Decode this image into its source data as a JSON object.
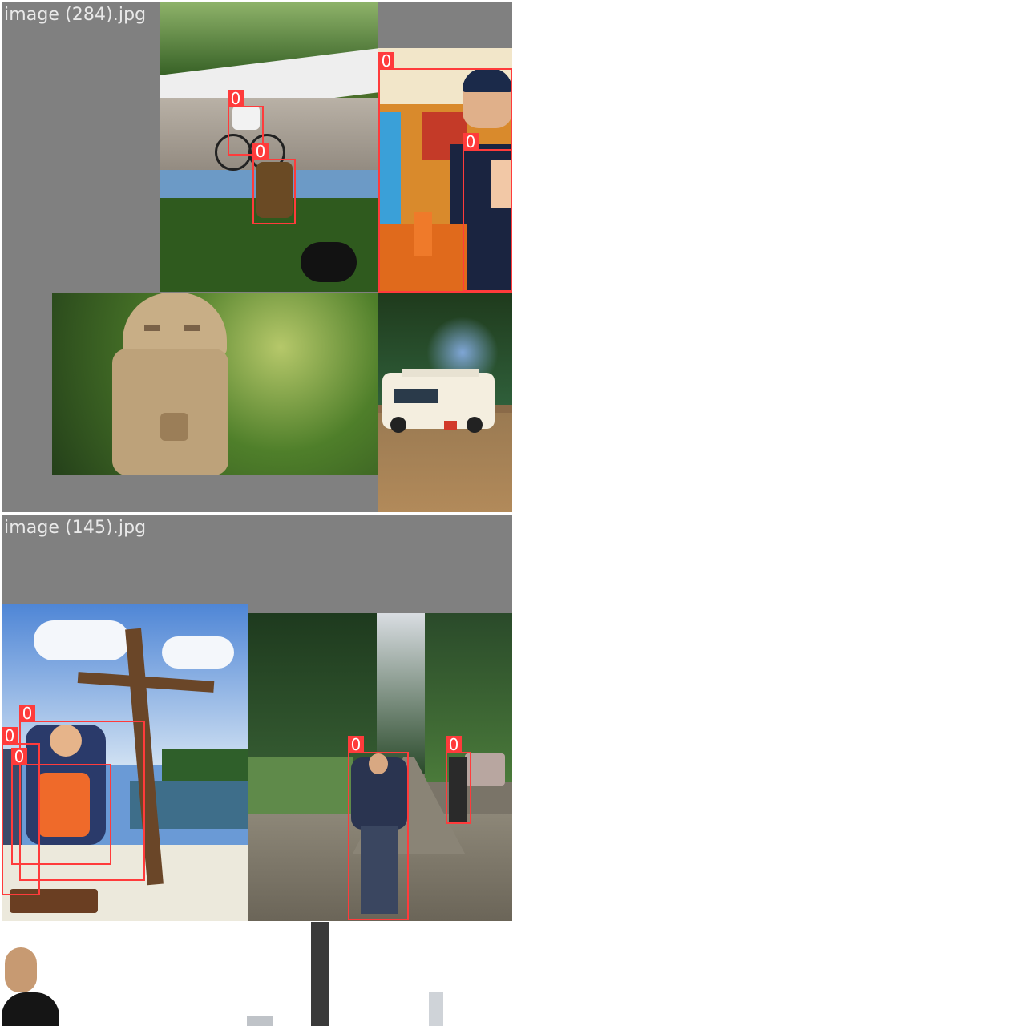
{
  "mosaics": [
    {
      "filename": "image (284).jpg",
      "detections": [
        {
          "class_id": "0"
        },
        {
          "class_id": "0"
        },
        {
          "class_id": "0"
        },
        {
          "class_id": "0"
        }
      ]
    },
    {
      "filename": "image (145).jpg",
      "detections": [
        {
          "class_id": "0"
        },
        {
          "class_id": "0"
        },
        {
          "class_id": "0"
        },
        {
          "class_id": "0"
        },
        {
          "class_id": "0"
        }
      ]
    }
  ],
  "colors": {
    "tile_background": "#808080",
    "box_color": "#ff3b3b",
    "label_text": "#e9e9e9"
  }
}
